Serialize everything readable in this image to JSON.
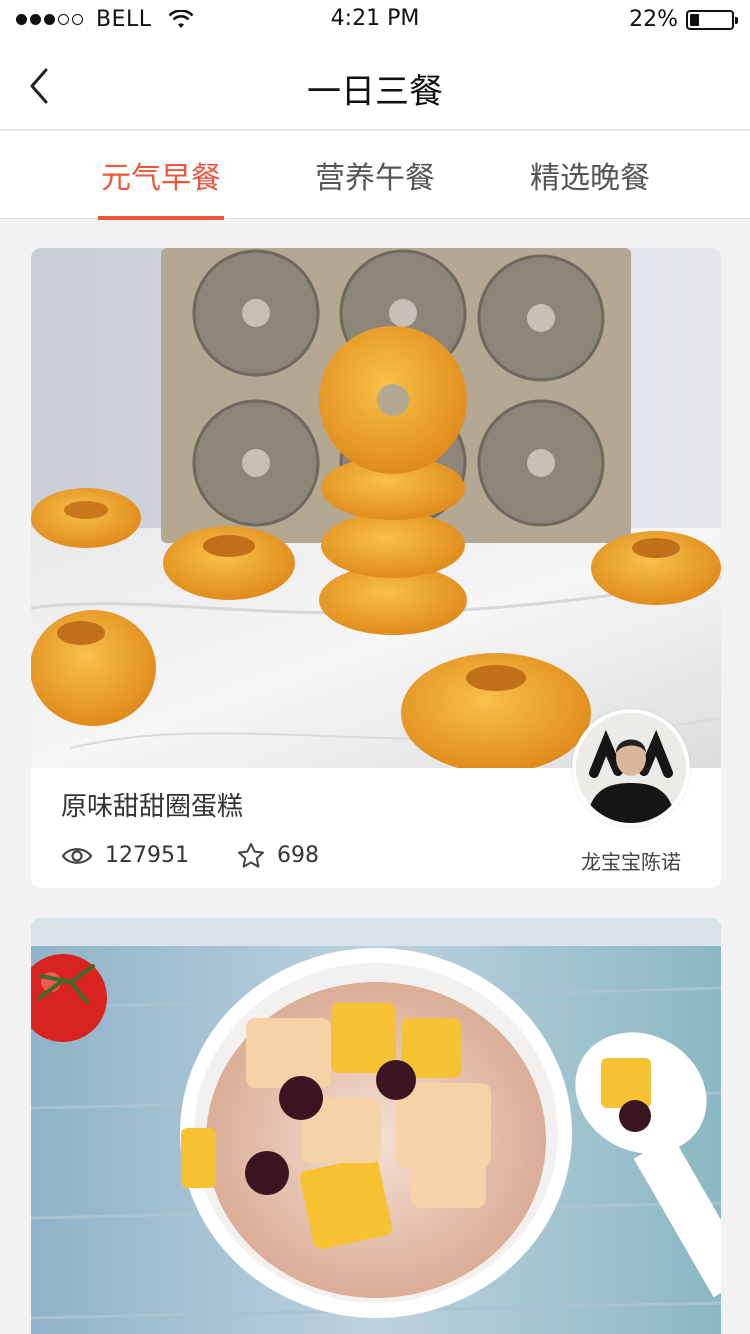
{
  "status_bar": {
    "carrier": "BELL",
    "time": "4:21 PM",
    "battery": "22%",
    "battery_level": 0.22,
    "signal_bars": 3,
    "signal_total": 5
  },
  "nav": {
    "title": "一日三餐",
    "back_icon": "chevron-left-icon"
  },
  "tabs": [
    {
      "label": "元气早餐",
      "active": true
    },
    {
      "label": "营养午餐",
      "active": false
    },
    {
      "label": "精选晚餐",
      "active": false
    }
  ],
  "colors": {
    "accent": "#f0553c",
    "background": "#f2f2f2"
  },
  "recipes": [
    {
      "title": "原味甜甜圈蛋糕",
      "views": "127951",
      "favorites": "698",
      "author": "龙宝宝陈诺",
      "view_icon": "eye-icon",
      "fav_icon": "star-icon"
    },
    {
      "title": "",
      "views": "",
      "favorites": "",
      "author": ""
    }
  ]
}
